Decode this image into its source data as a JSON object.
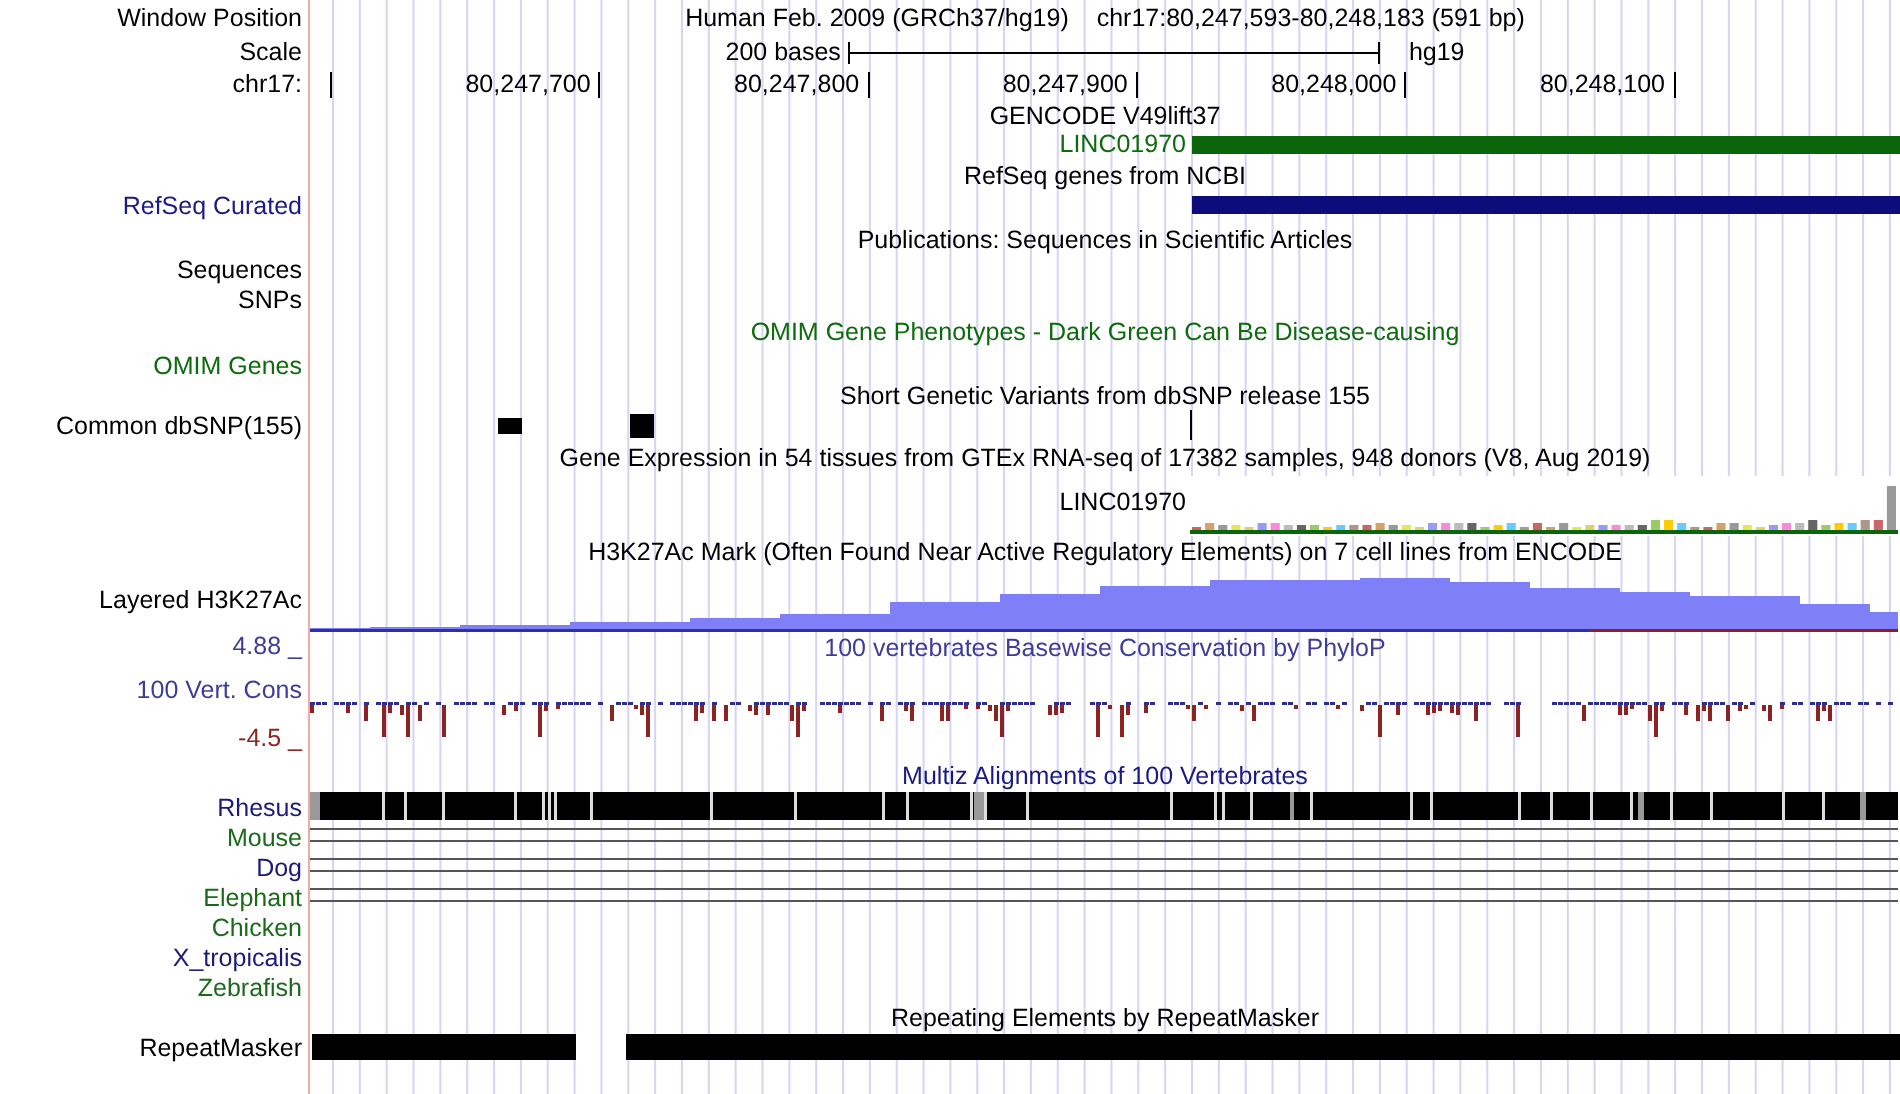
{
  "header": {
    "position_label": "Window Position",
    "assembly": "Human Feb. 2009 (GRCh37/hg19)",
    "position": "chr17:80,247,593-80,248,183 (591 bp)",
    "scale_label": "Scale",
    "scale_text": "200 bases",
    "scale_assembly": "hg19",
    "chrom_label": "chr17:",
    "ruler_labels": [
      "80,247,700",
      "80,247,800",
      "80,247,900",
      "80,248,000",
      "80,248,100"
    ]
  },
  "tracks": [
    {
      "kind": "gencode",
      "title": "GENCODE V49lift37",
      "feature_label": "LINC01970"
    },
    {
      "kind": "refseq",
      "title": "RefSeq genes from NCBI",
      "label": "RefSeq Curated"
    },
    {
      "kind": "title",
      "title": "Publications: Sequences in Scientific Articles"
    },
    {
      "kind": "label",
      "label": "Sequences"
    },
    {
      "kind": "label",
      "label": "SNPs"
    },
    {
      "kind": "omim",
      "title": "OMIM Gene Phenotypes - Dark Green Can Be Disease-causing",
      "label": "OMIM Genes"
    },
    {
      "kind": "snp",
      "title": "Short Genetic Variants from dbSNP release 155",
      "label": "Common dbSNP(155)"
    },
    {
      "kind": "gtex",
      "title": "Gene Expression in 54 tissues from GTEx RNA-seq of 17382 samples, 948 donors (V8, Aug 2019)",
      "feature_label": "LINC01970"
    },
    {
      "kind": "h3k27ac",
      "title": "H3K27Ac Mark (Often Found Near Active Regulatory Elements) on 7 cell lines from ENCODE",
      "label": "Layered H3K27Ac"
    },
    {
      "kind": "phylop",
      "title": "100 vertebrates Basewise Conservation by PhyloP",
      "label": "100 Vert. Cons",
      "max": "4.88 _",
      "min": "-4.5 _"
    },
    {
      "kind": "multiz",
      "title": "Multiz Alignments of 100 Vertebrates",
      "species": [
        {
          "name": "Rhesus",
          "kind": "blocks",
          "color": "#1a1a7a"
        },
        {
          "name": "Mouse",
          "kind": "lines",
          "color": "#1a6a1a"
        },
        {
          "name": "Dog",
          "kind": "lines",
          "color": "#1a1a7a"
        },
        {
          "name": "Elephant",
          "kind": "lines",
          "color": "#1a6a1a"
        },
        {
          "name": "Chicken",
          "kind": "empty",
          "color": "#1a6a1a"
        },
        {
          "name": "X_tropicalis",
          "kind": "empty",
          "color": "#1a1a7a"
        },
        {
          "name": "Zebrafish",
          "kind": "empty",
          "color": "#1a6a1a"
        }
      ]
    },
    {
      "kind": "rmsk",
      "title": "Repeating Elements by RepeatMasker",
      "label": "RepeatMasker"
    }
  ]
}
